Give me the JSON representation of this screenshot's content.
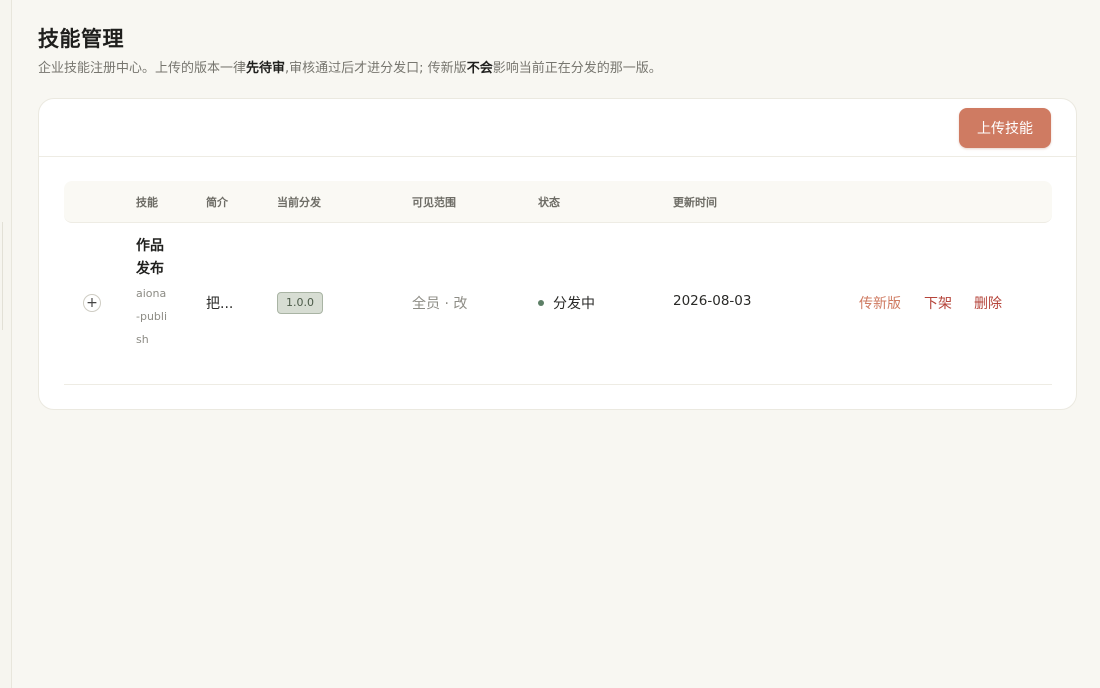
{
  "page": {
    "title": "技能管理",
    "subtitle_parts": [
      {
        "text": "企业技能注册中心。上传的版本一律",
        "bold": false
      },
      {
        "text": "先待审",
        "bold": true
      },
      {
        "text": ",审核通过后才进分发口; 传新版",
        "bold": false
      },
      {
        "text": "不会",
        "bold": true
      },
      {
        "text": "影响当前正在分发的那一版。",
        "bold": false
      }
    ]
  },
  "toolbar": {
    "upload_label": "上传技能"
  },
  "table": {
    "columns": [
      "技能",
      "简介",
      "当前分发",
      "可见范围",
      "状态",
      "更新时间"
    ],
    "rows": [
      {
        "expand": "+",
        "name": "作品发布",
        "slug": "aiona-publish",
        "description": "把...",
        "version": "1.0.0",
        "scope": "全员 · 改",
        "status": "分发中",
        "updated": "2026-08-03",
        "actions": [
          "传新版",
          "下架",
          "删除"
        ]
      }
    ]
  },
  "colors": {
    "accent": "#cf7b62",
    "danger": "#b5443a",
    "status_active": "#5d7f66",
    "background": "#f8f7f2"
  },
  "icons": {
    "expand": "plus-icon",
    "status": "status-dot-icon"
  }
}
